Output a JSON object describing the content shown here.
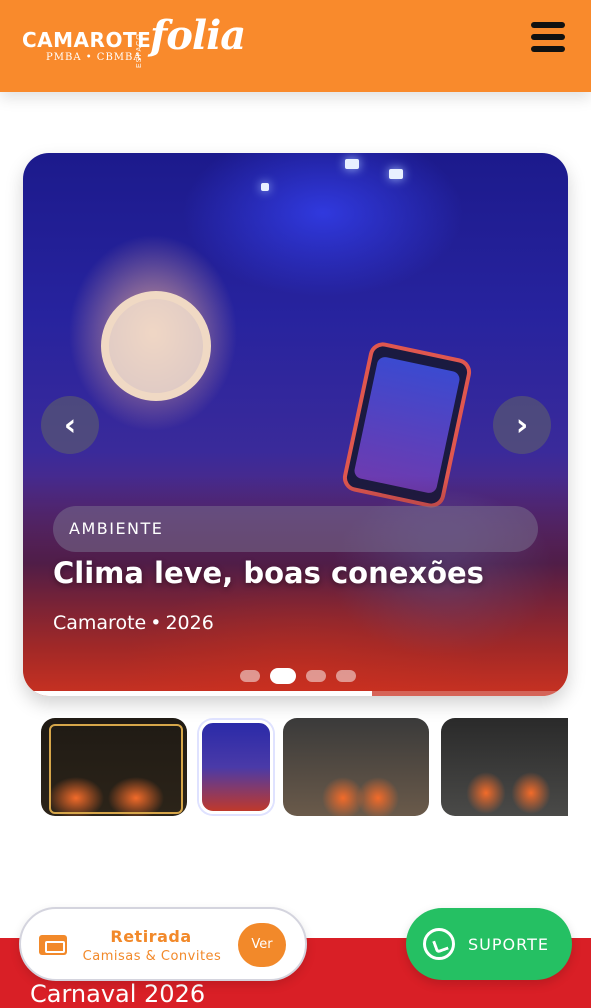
{
  "header": {
    "logo": {
      "brand": "CAMAROTE",
      "sub": "PMBA • CBMBA",
      "espaco": "ESPAÇO",
      "folia": "folia"
    },
    "menu_icon": "hamburger-menu-icon"
  },
  "carousel": {
    "category": "AMBIENTE",
    "title": "Clima leve, boas conexões",
    "subtitle_place": "Camarote",
    "subtitle_sep": "•",
    "subtitle_year": "2026",
    "prev_icon": "chevron-left-icon",
    "next_icon": "chevron-right-icon",
    "prev_glyph": "‹",
    "next_glyph": "›",
    "slide_count": 4,
    "active_slide": 2,
    "progress": 0.64
  },
  "thumbnails": [
    {
      "name": "thumb-photo-1"
    },
    {
      "name": "thumb-photo-2",
      "active": true
    },
    {
      "name": "thumb-photo-3"
    },
    {
      "name": "thumb-photo-4"
    }
  ],
  "banner": {
    "text": "Carnaval 2026"
  },
  "retirada": {
    "title": "Retirada",
    "subtitle": "Camisas & Convites",
    "button_label": "Ver",
    "icon": "ticket-icon"
  },
  "suporte": {
    "label": "SUPORTE",
    "icon": "whatsapp-icon"
  },
  "colors": {
    "header": "#f98a2c",
    "accent": "#f2892a",
    "banner": "#d91f26",
    "whatsapp": "#25c063"
  }
}
